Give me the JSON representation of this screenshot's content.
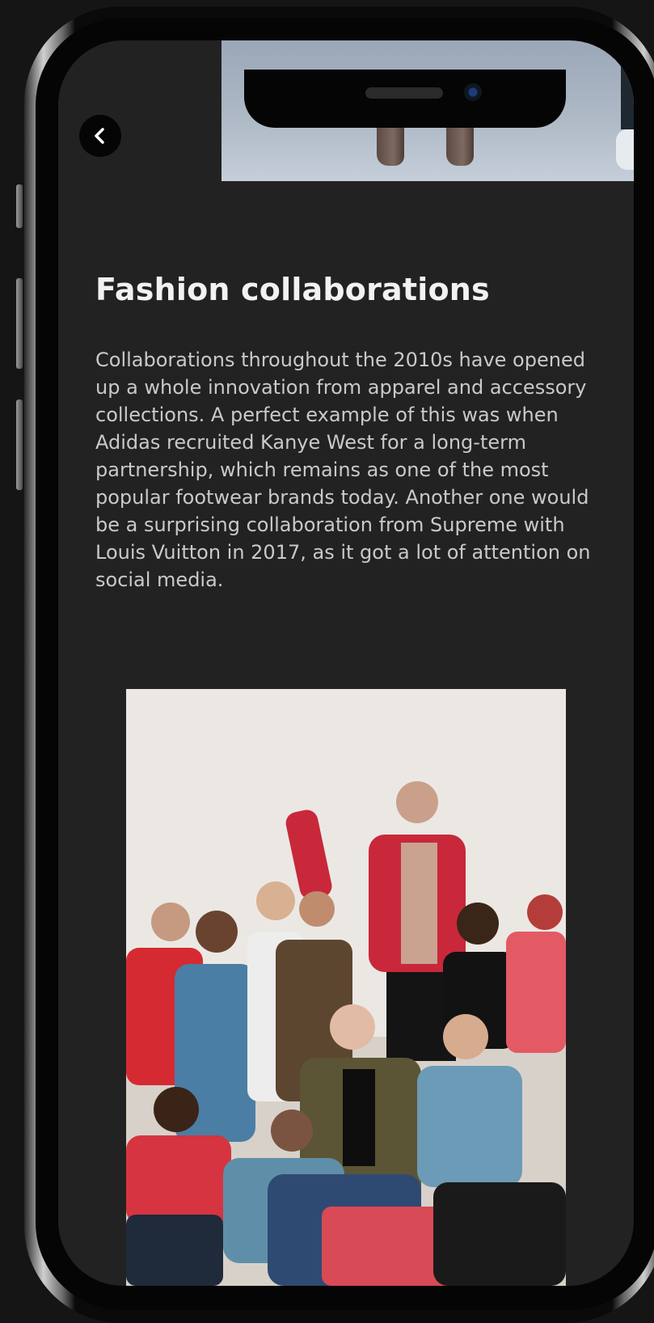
{
  "app": {
    "back_label": "",
    "hero_image_alt": "",
    "photo_alt": ""
  },
  "article": {
    "title": "Fashion collaborations",
    "body": "Collaborations throughout the 2010s have opened up a whole innovation from apparel and accessory collections. A perfect example of this was when Adidas recruited Kanye West for a long-term partnership, which remains as one of the most popular footwear brands today. Another one would be a surprising collaboration from Supreme with Louis Vuitton in 2017, as it got a lot of attention on social media."
  },
  "icons": {
    "back": "chevron-left-icon"
  },
  "colors": {
    "screen_background": "#222222",
    "title_text": "#f2f2f2",
    "body_text": "#c9c9c9",
    "back_button": "#050505"
  }
}
